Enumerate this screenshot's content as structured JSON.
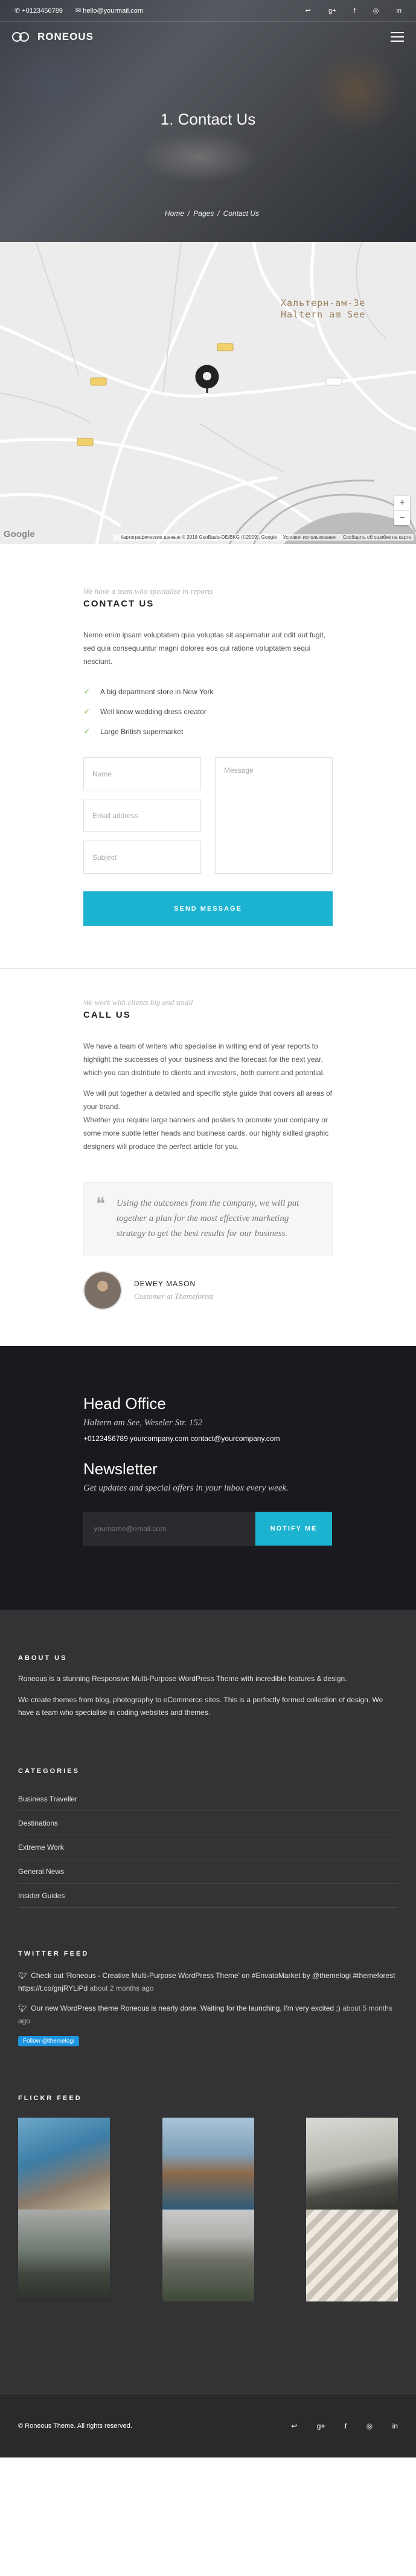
{
  "topbar": {
    "phone": "+0123456789",
    "email": "hello@yourmail.com",
    "socials": [
      "↩",
      "g+",
      "f",
      "◎",
      "in"
    ]
  },
  "brand": {
    "name": "RONEOUS"
  },
  "hero": {
    "title": "1. Contact Us",
    "breadcrumb": [
      "Home",
      "Pages",
      "Contact Us"
    ]
  },
  "map": {
    "place_line1": "Хальтерн-ам-Зе",
    "place_line2": "Haltern am See",
    "road_labels": [
      "L551",
      "B58",
      "L551",
      "L612"
    ],
    "zoom_in": "+",
    "zoom_out": "−",
    "google": "Google",
    "attribution": "Картографические данные © 2018 GeoBasis-DE/BKG (©2009), Google",
    "terms": "Условия использования",
    "report": "Сообщить об ошибке на карте"
  },
  "contact": {
    "kicker": "We have a team who specialise in reports",
    "heading": "CONTACT US",
    "paragraph": "Nemo enim ipsam voluptatem quia voluptas sit aspernatur aut odit aut fugit, sed quia consequuntur magni dolores eos qui ratione voluptatem sequi nesciunt.",
    "checks": [
      "A big department store in New York",
      "Well know wedding dress creator",
      "Large British supermarket"
    ],
    "form": {
      "name_placeholder": "Name",
      "email_placeholder": "Email address",
      "subject_placeholder": "Subject",
      "message_placeholder": "Message",
      "send_label": "SEND MESSAGE"
    }
  },
  "call": {
    "kicker": "We work with clients big and small",
    "heading": "CALL US",
    "p1": "We have a team of writers who specialise in writing end of year reports to highlight the successes of your business and the forecast for the next year, which you can distribute to clients and investors, both current and potential.",
    "p2": "We will put together a detailed and specific style guide that covers all areas of your brand.",
    "p3": "Whether you require large banners and posters to promote your company or some more subtle letter heads and business cards, our highly skilled graphic designers will produce the perfect article for you.",
    "quote": "Using the outcomes from the company, we will put together a plan for the most effective marketing strategy to get the best results for our business.",
    "author_name": "DEWEY MASON",
    "author_role": "Customer at Themeforest"
  },
  "office": {
    "title": "Head Office",
    "address": "Haltern am See, Weseler Str. 152",
    "info": "+0123456789 yourcompany.com contact@yourcompany.com",
    "newsletter_title": "Newsletter",
    "newsletter_sub": "Get updates and special offers in your inbox every week.",
    "email_placeholder": "yourname@email.com",
    "notify_label": "NOTIFY ME"
  },
  "footer": {
    "about_title": "ABOUT US",
    "about_p1": "Roneous is a stunning Responsive Multi-Purpose WordPress Theme with incredible features & design.",
    "about_p2": "We create themes from blog, photography to eCommerce sites. This is a perfectly formed collection of design. We have a team who specialise in coding websites and themes.",
    "categories_title": "CATEGORIES",
    "categories": [
      "Business Traveller",
      "Destinations",
      "Extreme Work",
      "General News",
      "Insider Guides"
    ],
    "twitter_title": "TWITTER FEED",
    "tweets": [
      {
        "text": "Check out 'Roneous - Creative Multi-Purpose WordPress Theme' on #EnvatoMarket by @themelogi #themeforest https://t.co/gnjRYLiPd",
        "ago": "about 2 months ago"
      },
      {
        "text": "Our new WordPress theme Roneous is nearly done. Waiting for the launching, I'm very excited ;)",
        "ago": "about 5 months ago"
      }
    ],
    "follow_label": "Follow @themelogi",
    "flickr_title": "FLICKR FEED",
    "copyright": "© Roneous Theme. All rights reserved.",
    "bottom_socials": [
      "↩",
      "g+",
      "f",
      "◎",
      "in"
    ]
  }
}
